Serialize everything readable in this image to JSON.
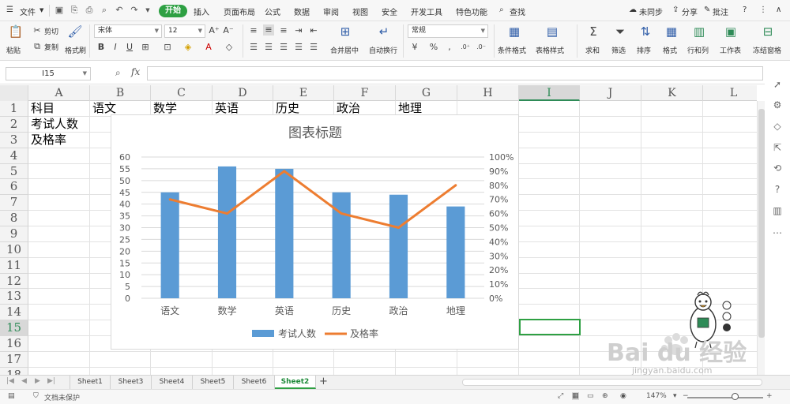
{
  "menubar": {
    "file": "文件",
    "tabs": [
      "开始",
      "插入",
      "页面布局",
      "公式",
      "数据",
      "审阅",
      "视图",
      "安全",
      "开发工具",
      "特色功能"
    ],
    "search": "查找",
    "sync": "未同步",
    "share": "分享",
    "comment": "批注"
  },
  "ribbon": {
    "paste": "粘贴",
    "cut": "剪切",
    "copy": "复制",
    "format_painter": "格式刷",
    "font_name": "宋体",
    "font_size": "12",
    "merge_center": "合并居中",
    "wrap": "自动换行",
    "number_format": "常规",
    "percent": "%",
    "cond_format": "条件格式",
    "table_style": "表格样式",
    "sum": "求和",
    "filter": "筛选",
    "sort": "排序",
    "format": "格式",
    "rowcol": "行和列",
    "worksheet": "工作表",
    "freeze": "冻结窗格"
  },
  "formula_bar": {
    "cell_ref": "I15",
    "fx": "fx"
  },
  "grid": {
    "columns": [
      "A",
      "B",
      "C",
      "D",
      "E",
      "F",
      "G",
      "H",
      "I",
      "J",
      "K",
      "L"
    ],
    "rows": [
      "1",
      "2",
      "3",
      "4",
      "5",
      "6",
      "7",
      "8",
      "9",
      "10",
      "11",
      "12",
      "13",
      "14",
      "15",
      "16",
      "17",
      "18"
    ],
    "cells": {
      "A1": "科目",
      "B1": "语文",
      "C1": "数学",
      "D1": "英语",
      "E1": "历史",
      "F1": "政治",
      "G1": "地理",
      "A2": "考试人数",
      "A3": "及格率"
    },
    "selected_cell": "I15"
  },
  "chart_data": {
    "type": "bar",
    "title": "图表标题",
    "categories": [
      "语文",
      "数学",
      "英语",
      "历史",
      "政治",
      "地理"
    ],
    "series": [
      {
        "name": "考试人数",
        "type": "bar",
        "values": [
          45,
          56,
          55,
          45,
          44,
          39
        ],
        "axis": "left"
      },
      {
        "name": "及格率",
        "type": "line",
        "values": [
          0.7,
          0.6,
          0.9,
          0.6,
          0.5,
          0.8
        ],
        "axis": "right"
      }
    ],
    "ylim": [
      0,
      60
    ],
    "yticks": [
      "0",
      "5",
      "10",
      "15",
      "20",
      "25",
      "30",
      "35",
      "40",
      "45",
      "50",
      "55",
      "60"
    ],
    "y2lim": [
      0,
      1
    ],
    "y2ticks": [
      "0%",
      "10%",
      "20%",
      "30%",
      "40%",
      "50%",
      "60%",
      "70%",
      "80%",
      "90%",
      "100%"
    ],
    "grid": true,
    "legend": "bottom",
    "colors": {
      "bar": "#5b9bd5",
      "line": "#ed7d31"
    }
  },
  "sheet_tabs": {
    "tabs": [
      "Sheet1",
      "Sheet3",
      "Sheet4",
      "Sheet5",
      "Sheet6",
      "Sheet2"
    ],
    "active": "Sheet2",
    "add": "+"
  },
  "statusbar": {
    "protect": "文档未保护",
    "zoom": "147%"
  },
  "watermark": {
    "brand": "Bai du 经验",
    "url": "jingyan.baidu.com"
  }
}
